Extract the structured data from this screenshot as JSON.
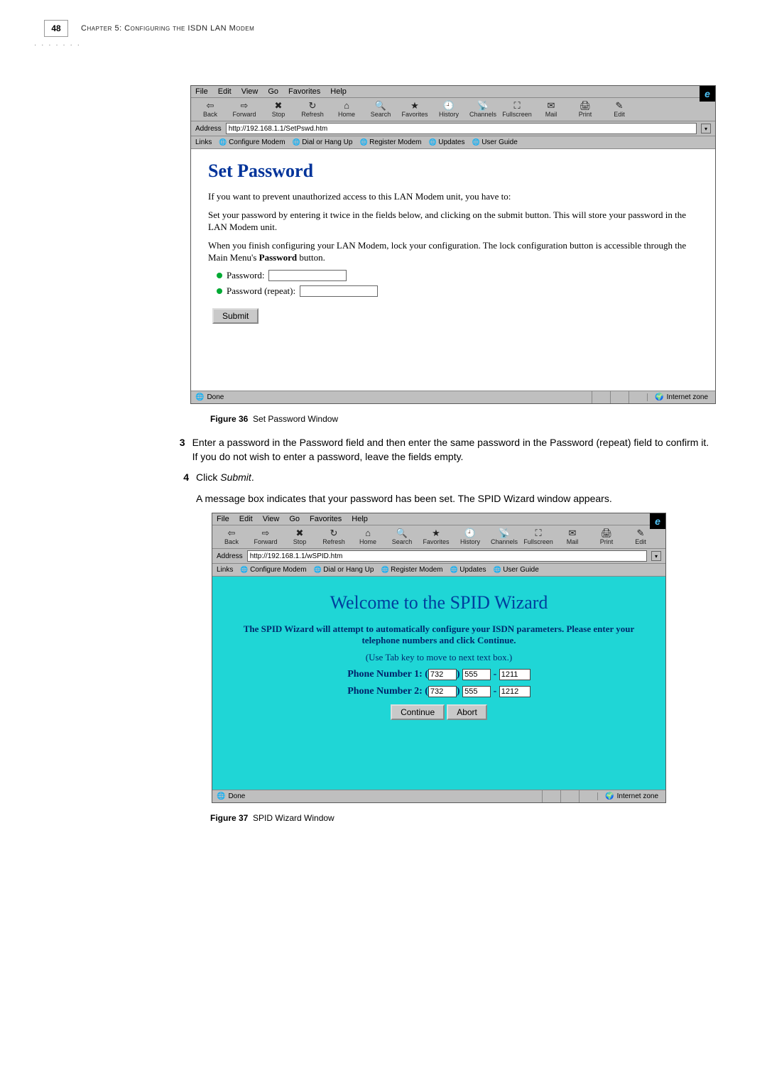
{
  "page_number": "48",
  "chapter_label": "Chapter 5: Configuring the ISDN LAN Modem",
  "menubar": {
    "file": "File",
    "edit": "Edit",
    "view": "View",
    "go": "Go",
    "favorites": "Favorites",
    "help": "Help"
  },
  "toolbar": [
    {
      "icon": "⇦",
      "label": "Back"
    },
    {
      "icon": "⇨",
      "label": "Forward"
    },
    {
      "icon": "✖",
      "label": "Stop"
    },
    {
      "icon": "↻",
      "label": "Refresh"
    },
    {
      "icon": "⌂",
      "label": "Home"
    },
    {
      "icon": "🔍",
      "label": "Search"
    },
    {
      "icon": "★",
      "label": "Favorites"
    },
    {
      "icon": "🕘",
      "label": "History"
    },
    {
      "icon": "📡",
      "label": "Channels"
    },
    {
      "icon": "⛶",
      "label": "Fullscreen"
    },
    {
      "icon": "✉",
      "label": "Mail"
    },
    {
      "icon": "🖨",
      "label": "Print"
    },
    {
      "icon": "✎",
      "label": "Edit"
    }
  ],
  "links_label": "Links",
  "links": [
    "Configure Modem",
    "Dial or Hang Up",
    "Register Modem",
    "Updates",
    "User Guide"
  ],
  "browser1": {
    "address_label": "Address",
    "address": "http://192.168.1.1/SetPswd.htm",
    "title": "Set Password",
    "p1": "If you want to prevent unauthorized access to this LAN Modem unit, you have to:",
    "p2": "Set your password by entering it twice in the fields below, and clicking on the submit button. This will store your password in the LAN Modem unit.",
    "p3_a": "When you finish configuring your LAN Modem, lock your configuration. The lock configuration button is accessible through the Main Menu's ",
    "p3_b": "Password",
    "p3_c": " button.",
    "pwd_label": "Password:",
    "pwd_repeat_label": "Password (repeat):",
    "submit": "Submit",
    "status_left": "Done",
    "status_zone": "Internet zone"
  },
  "fig36": {
    "label": "Figure 36",
    "caption": "Set Password Window"
  },
  "step3": {
    "num": "3",
    "text": "Enter a password in the Password field and then enter the same password in the Password (repeat) field to confirm it. If you do not wish to enter a password, leave the fields empty."
  },
  "step4": {
    "num": "4",
    "text_a": "Click ",
    "text_em": "Submit",
    "text_b": "."
  },
  "para_after": "A message box indicates that your password has been set. The SPID Wizard window appears.",
  "browser2": {
    "address_label": "Address",
    "address": "http://192.168.1.1/wSPID.htm",
    "title": "Welcome to the SPID Wizard",
    "body1": "The SPID Wizard will attempt to automatically configure your ISDN parameters. Please enter your telephone numbers and click Continue.",
    "body2": "(Use Tab key to move to next text box.)",
    "phone1_label": "Phone Number 1:",
    "phone1": {
      "area": "732",
      "prefix": "555",
      "line": "1211"
    },
    "phone2_label": "Phone Number 2:",
    "phone2": {
      "area": "732",
      "prefix": "555",
      "line": "1212"
    },
    "continue": "Continue",
    "abort": "Abort",
    "status_left": "Done",
    "status_zone": "Internet zone"
  },
  "fig37": {
    "label": "Figure 37",
    "caption": "SPID Wizard Window"
  }
}
